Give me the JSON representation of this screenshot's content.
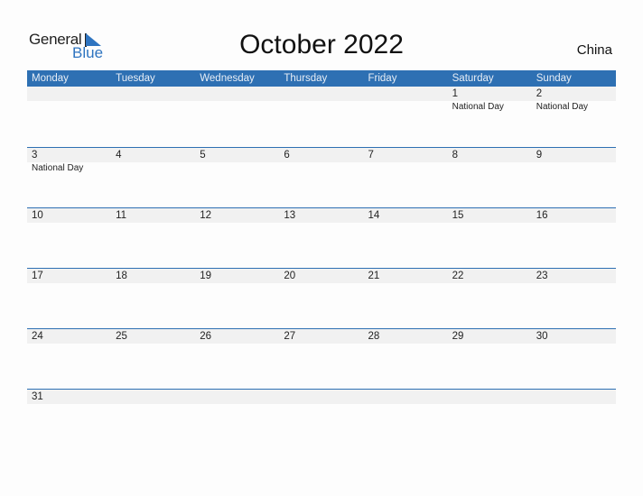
{
  "logo": {
    "line1": "General",
    "line2": "Blue"
  },
  "title": "October 2022",
  "country": "China",
  "weekdays": [
    "Monday",
    "Tuesday",
    "Wednesday",
    "Thursday",
    "Friday",
    "Saturday",
    "Sunday"
  ],
  "weeks": [
    [
      {
        "d": "",
        "e": ""
      },
      {
        "d": "",
        "e": ""
      },
      {
        "d": "",
        "e": ""
      },
      {
        "d": "",
        "e": ""
      },
      {
        "d": "",
        "e": ""
      },
      {
        "d": "1",
        "e": "National Day"
      },
      {
        "d": "2",
        "e": "National Day"
      }
    ],
    [
      {
        "d": "3",
        "e": "National Day"
      },
      {
        "d": "4",
        "e": ""
      },
      {
        "d": "5",
        "e": ""
      },
      {
        "d": "6",
        "e": ""
      },
      {
        "d": "7",
        "e": ""
      },
      {
        "d": "8",
        "e": ""
      },
      {
        "d": "9",
        "e": ""
      }
    ],
    [
      {
        "d": "10",
        "e": ""
      },
      {
        "d": "11",
        "e": ""
      },
      {
        "d": "12",
        "e": ""
      },
      {
        "d": "13",
        "e": ""
      },
      {
        "d": "14",
        "e": ""
      },
      {
        "d": "15",
        "e": ""
      },
      {
        "d": "16",
        "e": ""
      }
    ],
    [
      {
        "d": "17",
        "e": ""
      },
      {
        "d": "18",
        "e": ""
      },
      {
        "d": "19",
        "e": ""
      },
      {
        "d": "20",
        "e": ""
      },
      {
        "d": "21",
        "e": ""
      },
      {
        "d": "22",
        "e": ""
      },
      {
        "d": "23",
        "e": ""
      }
    ],
    [
      {
        "d": "24",
        "e": ""
      },
      {
        "d": "25",
        "e": ""
      },
      {
        "d": "26",
        "e": ""
      },
      {
        "d": "27",
        "e": ""
      },
      {
        "d": "28",
        "e": ""
      },
      {
        "d": "29",
        "e": ""
      },
      {
        "d": "30",
        "e": ""
      }
    ],
    [
      {
        "d": "31",
        "e": ""
      },
      {
        "d": "",
        "e": ""
      },
      {
        "d": "",
        "e": ""
      },
      {
        "d": "",
        "e": ""
      },
      {
        "d": "",
        "e": ""
      },
      {
        "d": "",
        "e": ""
      },
      {
        "d": "",
        "e": ""
      }
    ]
  ]
}
